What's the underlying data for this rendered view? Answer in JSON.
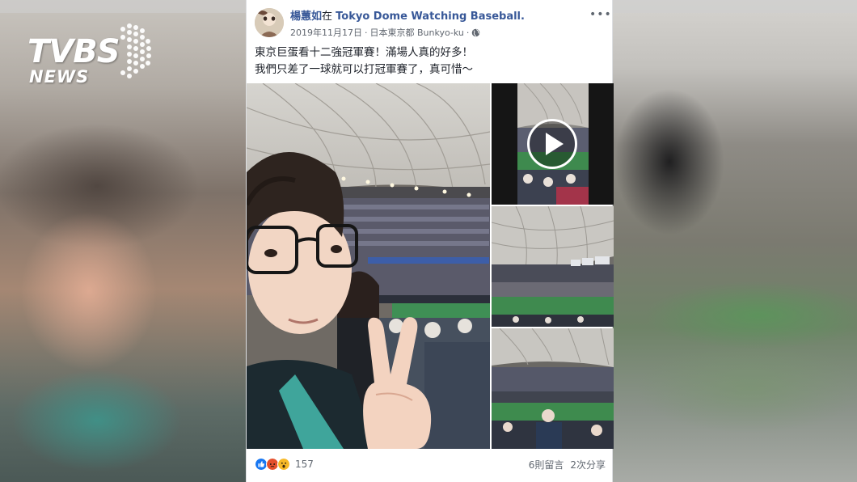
{
  "brand": {
    "logo_main": "TVBS",
    "logo_sub": "NEWS"
  },
  "post": {
    "author": "楊蕙如",
    "location_prefix": "在 ",
    "location": "Tokyo Dome Watching Baseball.",
    "date": "2019年11月17日",
    "place": "日本東京都 Bunkyo-ku",
    "separator": "·",
    "more_icon": "•••",
    "text_line1": "東京巨蛋看十二強冠軍賽！滿場人真的好多！",
    "text_line2": "我們只差了一球就可以打冠軍賽了，真可惜～",
    "reaction_count": "157",
    "comments": "6則留言",
    "shares": "2次分享"
  },
  "colors": {
    "link": "#385898",
    "meta": "#616770",
    "like": "#1877f2",
    "angry": "#e4502d",
    "wow": "#f7b928"
  }
}
